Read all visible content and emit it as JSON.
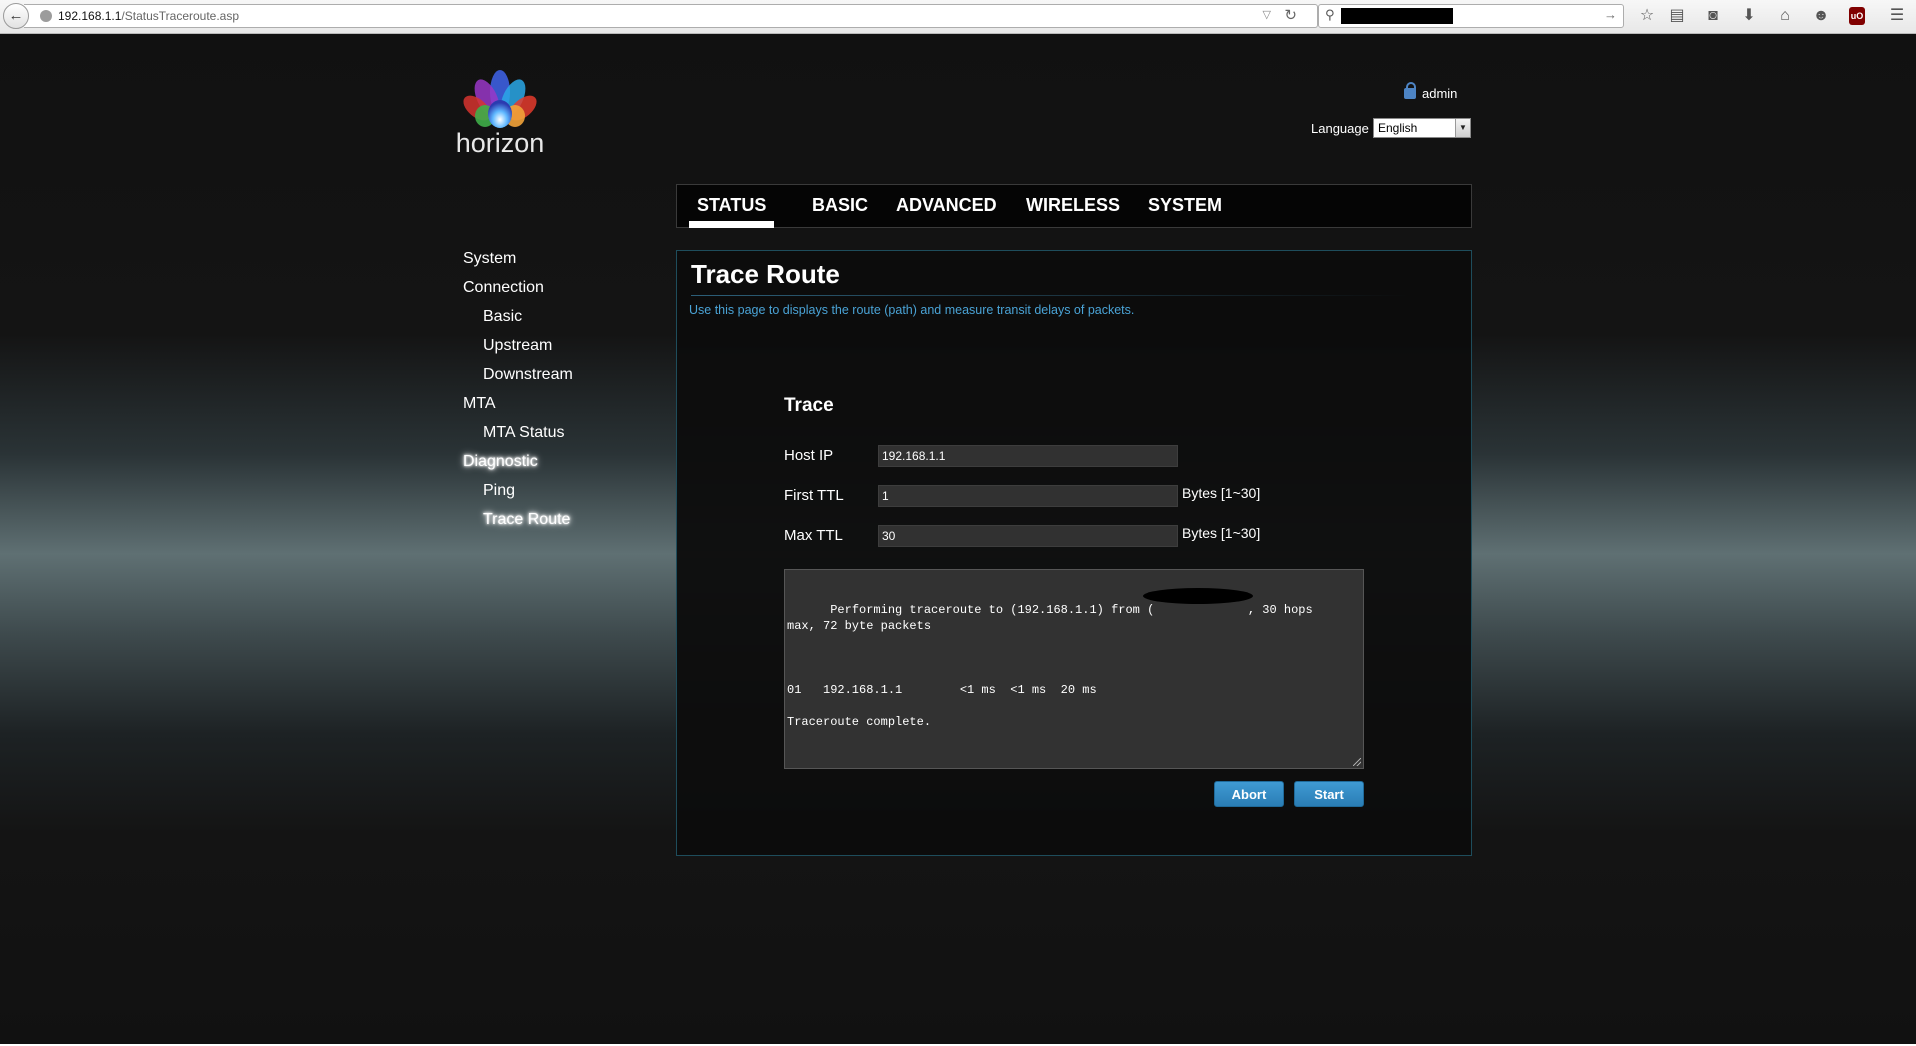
{
  "browser": {
    "url_host": "192.168.1.1",
    "url_path": "/StatusTraceroute.asp",
    "icons": [
      "back-arrow-icon",
      "reload-icon",
      "search-icon",
      "bookmark-star-icon",
      "reading-list-icon",
      "pocket-icon",
      "download-icon",
      "home-icon",
      "chat-icon",
      "ublock-icon",
      "menu-icon"
    ],
    "ublock_label": "uO"
  },
  "brand": {
    "logo_text": "horizon"
  },
  "header": {
    "user": "admin",
    "language_label": "Language",
    "language_value": "English"
  },
  "nav": {
    "tabs": [
      {
        "label": "STATUS",
        "active": true
      },
      {
        "label": "BASIC",
        "active": false
      },
      {
        "label": "ADVANCED",
        "active": false
      },
      {
        "label": "WIRELESS",
        "active": false
      },
      {
        "label": "SYSTEM",
        "active": false
      }
    ]
  },
  "sidebar": {
    "items": [
      {
        "label": "System",
        "level": 0,
        "active": false
      },
      {
        "label": "Connection",
        "level": 0,
        "active": false
      },
      {
        "label": "Basic",
        "level": 1,
        "active": false
      },
      {
        "label": "Upstream",
        "level": 1,
        "active": false
      },
      {
        "label": "Downstream",
        "level": 1,
        "active": false
      },
      {
        "label": "MTA",
        "level": 0,
        "active": false
      },
      {
        "label": "MTA Status",
        "level": 1,
        "active": false
      },
      {
        "label": "Diagnostic",
        "level": 0,
        "active": true
      },
      {
        "label": "Ping",
        "level": 1,
        "active": false
      },
      {
        "label": "Trace Route",
        "level": 1,
        "active": true
      }
    ]
  },
  "main": {
    "title": "Trace Route",
    "description": "Use this page to displays the route (path) and measure transit delays of packets.",
    "section_title": "Trace",
    "fields": {
      "host_ip": {
        "label": "Host IP",
        "value": "192.168.1.1"
      },
      "first_ttl": {
        "label": "First TTL",
        "value": "1",
        "unit": "Bytes [1~30]"
      },
      "max_ttl": {
        "label": "Max TTL",
        "value": "30",
        "unit": "Bytes [1~30]"
      }
    },
    "output": "Performing traceroute to (192.168.1.1) from (             , 30 hops\nmax, 72 byte packets\n\n\n\n01   192.168.1.1        <1 ms  <1 ms  20 ms\n\nTraceroute complete.",
    "buttons": {
      "abort": "Abort",
      "start": "Start"
    }
  },
  "colors": {
    "accent": "#3a93cf",
    "description_text": "#4aa3d6",
    "panel_border": "#1e4d5c"
  }
}
